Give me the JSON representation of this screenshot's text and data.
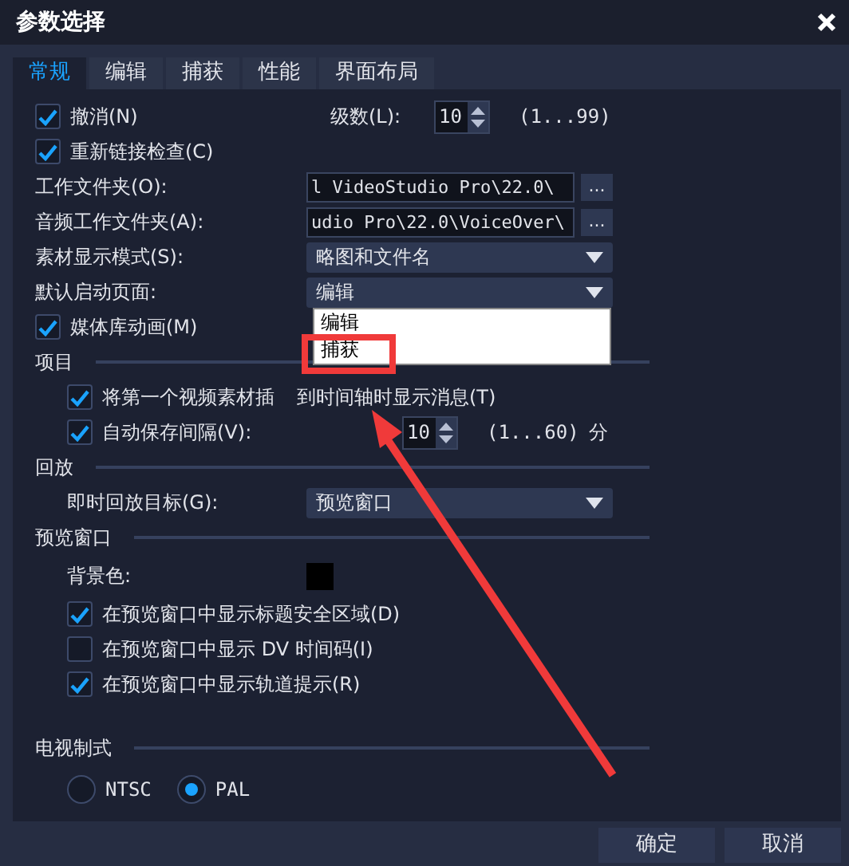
{
  "window": {
    "title": "参数选择"
  },
  "tabs": [
    {
      "label": "常规",
      "selected": true
    },
    {
      "label": "编辑",
      "selected": false
    },
    {
      "label": "捕获",
      "selected": false
    },
    {
      "label": "性能",
      "selected": false
    },
    {
      "label": "界面布局",
      "selected": false
    }
  ],
  "items": [
    {
      "kind": "checkbox_spin",
      "label": "撤消(N)",
      "checked": true,
      "spin_label": "级数(L):",
      "value": "10",
      "range": "(1...99)"
    },
    {
      "kind": "checkbox",
      "label": "重新链接检查(C)",
      "checked": true
    },
    {
      "kind": "path",
      "label": "工作文件夹(O):",
      "value": "l VideoStudio Pro\\22.0\\",
      "button": "..."
    },
    {
      "kind": "path",
      "label": "音频工作文件夹(A):",
      "value": "udio Pro\\22.0\\VoiceOver\\",
      "button": "..."
    },
    {
      "kind": "select",
      "label": "素材显示模式(S):",
      "value": "略图和文件名"
    },
    {
      "kind": "select",
      "label": "默认启动页面:",
      "value": "编辑",
      "expanded": true,
      "options": [
        "编辑",
        "捕获"
      ]
    },
    {
      "kind": "checkbox",
      "label": "媒体库动画(M)",
      "checked": true
    },
    {
      "kind": "heading",
      "label": "项目"
    },
    {
      "kind": "checkbox",
      "indent": true,
      "label": "将第一个视频素材插",
      "label_tail": "到时间轴时显示消息(T)",
      "checked": true
    },
    {
      "kind": "checkbox_spin",
      "indent": true,
      "label": "自动保存间隔(V):",
      "checked": true,
      "value": "10",
      "range": "(1...60)",
      "unit": "分"
    },
    {
      "kind": "heading",
      "label": "回放"
    },
    {
      "kind": "select",
      "indent": true,
      "label": "即时回放目标(G):",
      "value": "预览窗口"
    },
    {
      "kind": "heading",
      "label": "预览窗口"
    },
    {
      "kind": "color",
      "indent": true,
      "label": "背景色:",
      "color": "#000000"
    },
    {
      "kind": "checkbox",
      "indent": true,
      "label": "在预览窗口中显示标题安全区域(D)",
      "checked": true
    },
    {
      "kind": "checkbox",
      "indent": true,
      "label": "在预览窗口中显示 DV 时间码(I)",
      "checked": false
    },
    {
      "kind": "checkbox",
      "indent": true,
      "label": "在预览窗口中显示轨道提示(R)",
      "checked": true
    },
    {
      "kind": "heading",
      "label": "电视制式",
      "gap": true
    },
    {
      "kind": "radios",
      "options": [
        {
          "label": "NTSC",
          "selected": false
        },
        {
          "label": "PAL",
          "selected": true
        }
      ]
    }
  ],
  "buttons": [
    "确定",
    "取消"
  ]
}
